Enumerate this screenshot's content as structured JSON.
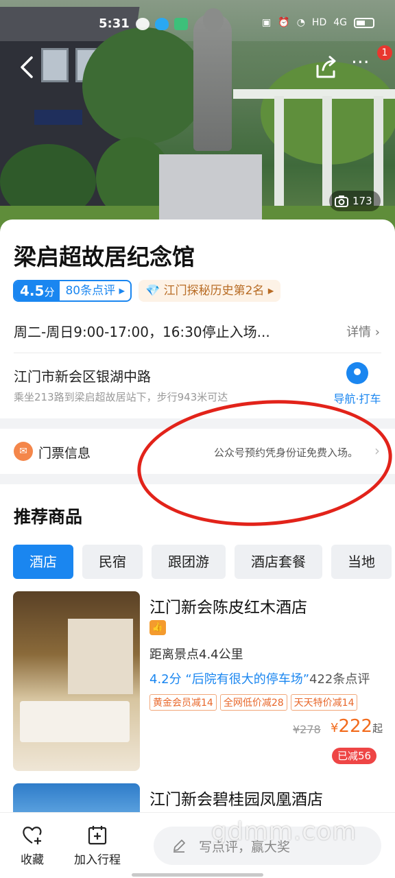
{
  "status_bar": {
    "time": "5:31",
    "network": "HD",
    "signal": "4G"
  },
  "header": {
    "notification_count": "1",
    "photo_count": "173"
  },
  "poi": {
    "title": "梁启超故居纪念馆",
    "rating_score": "4.5",
    "rating_unit": "分",
    "review_count": "80条点评",
    "rank": "江门探秘历史第2名",
    "hours": "周二-周日9:00-17:00，16:30停止入场...",
    "details_label": "详情",
    "address": "江门市新会区银湖中路",
    "transit": "乘坐213路到梁启超故居站下，步行943米可达",
    "navigate_label": "导航·打车"
  },
  "ticket": {
    "label": "门票信息",
    "value": "公众号预约凭身份证免费入场。"
  },
  "products": {
    "title": "推荐商品",
    "tabs": [
      "酒店",
      "民宿",
      "跟团游",
      "酒店套餐",
      "当地"
    ],
    "hotels": [
      {
        "name": "江门新会陈皮红木酒店",
        "distance": "距离景点4.4公里",
        "score": "4.2分",
        "quote": "“后院有很大的停车场”",
        "review_count": "422条点评",
        "promos": [
          "黄金会员减14",
          "全网低价减28",
          "天天特价减14"
        ],
        "old_price": "¥278",
        "currency": "¥",
        "price": "222",
        "price_suffix": "起",
        "saved": "已减56"
      },
      {
        "name": "江门新会碧桂园凤凰酒店"
      }
    ]
  },
  "bottom_bar": {
    "favorite_label": "收藏",
    "add_trip_label": "加入行程",
    "comment_placeholder": "写点评，赢大奖"
  },
  "watermark": "gdmm.com",
  "colors": {
    "accent": "#1a86f0",
    "price": "#f26b1d",
    "annotation": "#e2231a"
  }
}
